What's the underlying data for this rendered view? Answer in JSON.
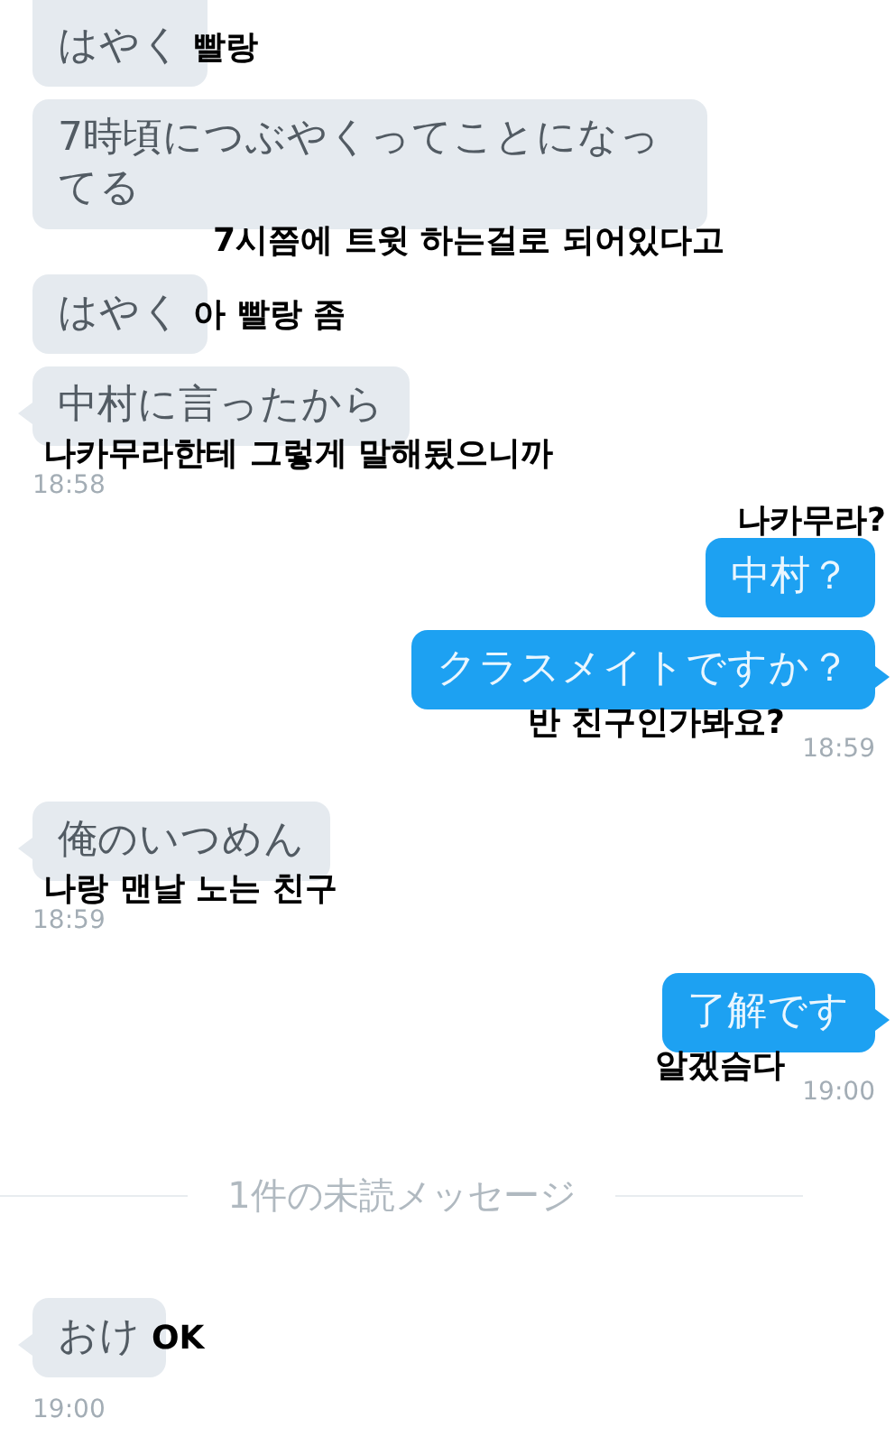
{
  "messages": [
    {
      "kind": "message",
      "outgoing": false,
      "text": "はやく",
      "tail": false,
      "translation": {
        "text": "빨랑",
        "kind": "beside"
      }
    },
    {
      "kind": "message",
      "outgoing": false,
      "text": "7時頃につぶやくってことになってる",
      "tail": false,
      "translation": {
        "text": "7시쯤에 트윗 하는걸로 되어있다고",
        "kind": "below"
      }
    },
    {
      "kind": "message",
      "outgoing": false,
      "text": "はやく",
      "tail": false,
      "translation": {
        "text": "아 빨랑 좀",
        "kind": "beside"
      }
    },
    {
      "kind": "message",
      "outgoing": false,
      "text": "中村に言ったから",
      "tail": true,
      "translation": {
        "text": "나카무라한테 그렇게 말해됬으니까",
        "kind": "below"
      },
      "time": "18:58"
    },
    {
      "kind": "message",
      "outgoing": true,
      "text": "中村？",
      "tail": false,
      "translation": {
        "text": "나카무라?",
        "kind": "above"
      }
    },
    {
      "kind": "message",
      "outgoing": true,
      "text": "クラスメイトですか？",
      "tail": true,
      "translation": {
        "text": "반 친구인가봐요?",
        "kind": "below"
      },
      "time": "18:59"
    },
    {
      "kind": "message",
      "outgoing": false,
      "text": "俺のいつめん",
      "tail": true,
      "translation": {
        "text": "나랑 맨날 노는 친구",
        "kind": "below"
      },
      "time": "18:59"
    },
    {
      "kind": "message",
      "outgoing": true,
      "text": "了解です",
      "tail": true,
      "translation": {
        "text": "알겠슴다",
        "kind": "below"
      },
      "time": "19:00"
    },
    {
      "kind": "divider",
      "text": "1件の未読メッセージ"
    },
    {
      "kind": "message",
      "outgoing": false,
      "text": "おけ",
      "tail": true,
      "translation": {
        "text": "OK",
        "kind": "beside"
      },
      "time": "19:00"
    }
  ]
}
